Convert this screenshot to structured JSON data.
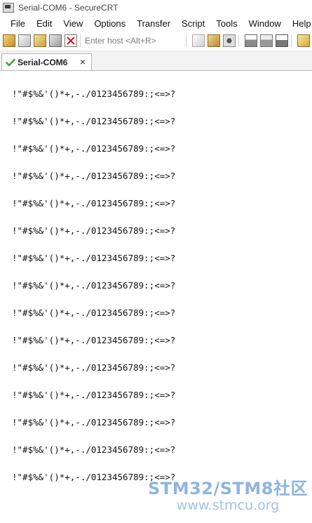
{
  "window": {
    "title": "Serial-COM6 - SecureCRT"
  },
  "menu": [
    "File",
    "Edit",
    "View",
    "Options",
    "Transfer",
    "Script",
    "Tools",
    "Window",
    "Help"
  ],
  "toolbar": {
    "host_placeholder": "Enter host <Alt+R>"
  },
  "tab": {
    "label": "Serial-COM6",
    "close": "×"
  },
  "terminal": {
    "lines": [
      "!\"#$%&'()*+,-./0123456789:;<=>?",
      "!\"#$%&'()*+,-./0123456789:;<=>?",
      "!\"#$%&'()*+,-./0123456789:;<=>?",
      "!\"#$%&'()*+,-./0123456789:;<=>?",
      "!\"#$%&'()*+,-./0123456789:;<=>?",
      "!\"#$%&'()*+,-./0123456789:;<=>?",
      "!\"#$%&'()*+,-./0123456789:;<=>?",
      "!\"#$%&'()*+,-./0123456789:;<=>?",
      "!\"#$%&'()*+,-./0123456789:;<=>?",
      "!\"#$%&'()*+,-./0123456789:;<=>?",
      "!\"#$%&'()*+,-./0123456789:;<=>?",
      "!\"#$%&'()*+,-./0123456789:;<=>?",
      "!\"#$%&'()*+,-./0123456789:;<=>?",
      "!\"#$%&'()*+,-./0123456789:;<=>?",
      "!\"#$%&'()*+,-./0123456789:;<=>?"
    ]
  },
  "watermark": {
    "line1": "STM32/STM8社区",
    "line2": "www.stmcu.org"
  },
  "colors": {
    "watermark": "#8fb5dc",
    "check": "#3aa83a",
    "disconnect": "#d01010"
  }
}
